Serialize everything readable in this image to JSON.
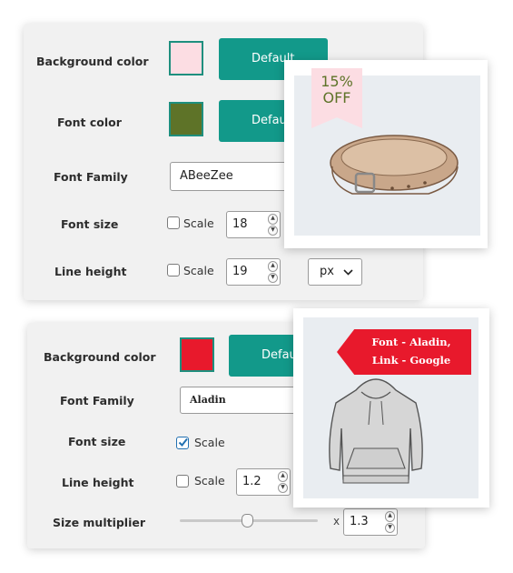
{
  "panel1": {
    "background_color": {
      "label": "Background color",
      "swatch": "#fcdde3",
      "button": "Default"
    },
    "font_color": {
      "label": "Font color",
      "swatch": "#5e7328",
      "button": "Default"
    },
    "font_family": {
      "label": "Font Family",
      "value": "ABeeZee"
    },
    "font_size": {
      "label": "Font size",
      "scale_label": "Scale",
      "scale_checked": false,
      "value": "18"
    },
    "line_height": {
      "label": "Line height",
      "scale_label": "Scale",
      "scale_checked": false,
      "value": "19",
      "unit": "px"
    }
  },
  "panel2": {
    "background_color": {
      "label": "Background color",
      "swatch": "#e8192c",
      "button": "Default"
    },
    "font_family": {
      "label": "Font Family",
      "value": "Aladin"
    },
    "font_size": {
      "label": "Font size",
      "scale_label": "Scale",
      "scale_checked": true
    },
    "line_height": {
      "label": "Line height",
      "scale_label": "Scale",
      "scale_checked": false,
      "value": "1.2"
    },
    "size_multiplier": {
      "label": "Size multiplier",
      "x_label": "x",
      "value": "1.3",
      "slider_fraction": 0.49
    }
  },
  "preview1": {
    "badge_line1": "15%",
    "badge_line2": "OFF",
    "badge_color": "#fcdde3",
    "badge_text_color": "#5e7328"
  },
  "preview2": {
    "ribbon_line1": "Font - Aladin,",
    "ribbon_line2": "Link - Google",
    "ribbon_color": "#e8192c"
  }
}
